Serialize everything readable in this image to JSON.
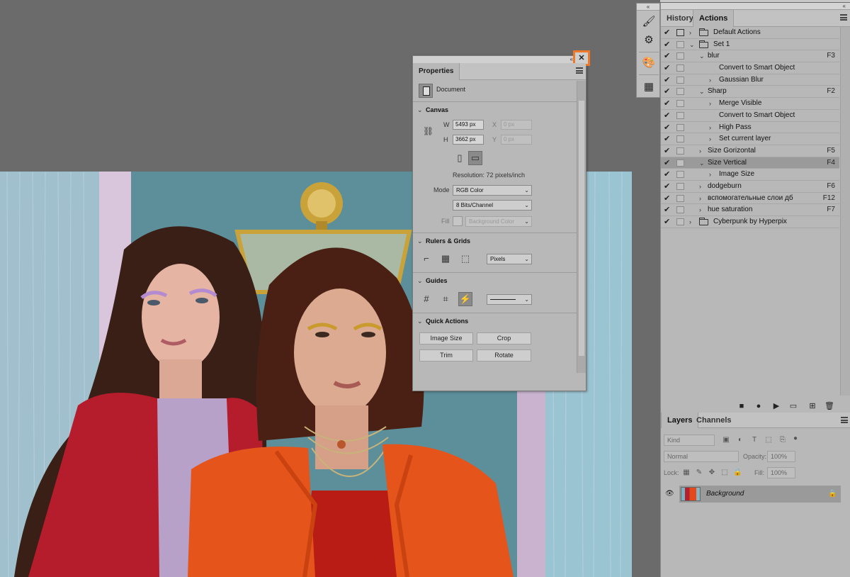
{
  "properties": {
    "tab": "Properties",
    "document_label": "Document",
    "canvas": {
      "title": "Canvas",
      "w_label": "W",
      "w_value": "5493 px",
      "h_label": "H",
      "h_value": "3662 px",
      "x_label": "X",
      "x_placeholder": "0 px",
      "y_label": "Y",
      "y_placeholder": "0 px",
      "resolution": "Resolution: 72 pixels/inch",
      "mode_label": "Mode",
      "mode_value": "RGB Color",
      "bits_value": "8 Bits/Channel",
      "fill_label": "Fill",
      "fill_value": "Background Color"
    },
    "rulers": {
      "title": "Rulers & Grids",
      "units": "Pixels"
    },
    "guides": {
      "title": "Guides"
    },
    "quick_actions": {
      "title": "Quick Actions",
      "buttons": [
        "Image Size",
        "Crop",
        "Trim",
        "Rotate"
      ]
    },
    "close_glyph": "✕",
    "collapse_glyph": "«"
  },
  "history_actions": {
    "tabs": [
      "History",
      "Actions"
    ],
    "active_tab": "Actions",
    "collapse_glyph": "«",
    "rows": [
      {
        "label": "Default Actions",
        "key": "",
        "level": 0,
        "caret": "›",
        "folder": true,
        "dialog": true,
        "selected": false
      },
      {
        "label": "Set 1",
        "key": "",
        "level": 0,
        "caret": "⌄",
        "folder": true,
        "dialog": false,
        "selected": false
      },
      {
        "label": "blur",
        "key": "F3",
        "level": 1,
        "caret": "⌄",
        "folder": false,
        "dialog": false,
        "selected": false
      },
      {
        "label": "Convert to Smart Object",
        "key": "",
        "level": 2,
        "caret": "",
        "folder": false,
        "dialog": false,
        "selected": false
      },
      {
        "label": "Gaussian Blur",
        "key": "",
        "level": 2,
        "caret": "›",
        "folder": false,
        "dialog": false,
        "selected": false
      },
      {
        "label": "Sharp",
        "key": "F2",
        "level": 1,
        "caret": "⌄",
        "folder": false,
        "dialog": false,
        "selected": false
      },
      {
        "label": "Merge Visible",
        "key": "",
        "level": 2,
        "caret": "›",
        "folder": false,
        "dialog": false,
        "selected": false
      },
      {
        "label": "Convert to Smart Object",
        "key": "",
        "level": 2,
        "caret": "",
        "folder": false,
        "dialog": false,
        "selected": false
      },
      {
        "label": "High Pass",
        "key": "",
        "level": 2,
        "caret": "›",
        "folder": false,
        "dialog": false,
        "selected": false
      },
      {
        "label": "Set current layer",
        "key": "",
        "level": 2,
        "caret": "›",
        "folder": false,
        "dialog": false,
        "selected": false
      },
      {
        "label": "Size Gorizontal",
        "key": "F5",
        "level": 1,
        "caret": "›",
        "folder": false,
        "dialog": false,
        "selected": false
      },
      {
        "label": "Size Vertical",
        "key": "F4",
        "level": 1,
        "caret": "⌄",
        "folder": false,
        "dialog": false,
        "selected": true
      },
      {
        "label": "Image Size",
        "key": "",
        "level": 2,
        "caret": "›",
        "folder": false,
        "dialog": false,
        "selected": false
      },
      {
        "label": "dodgeburn",
        "key": "F6",
        "level": 1,
        "caret": "›",
        "folder": false,
        "dialog": false,
        "selected": false
      },
      {
        "label": "вспомогательные слои дб",
        "key": "F12",
        "level": 1,
        "caret": "›",
        "folder": false,
        "dialog": false,
        "selected": false
      },
      {
        "label": "hue saturation",
        "key": "F7",
        "level": 1,
        "caret": "›",
        "folder": false,
        "dialog": false,
        "selected": false
      },
      {
        "label": "Cyberpunk by Hyperpix",
        "key": "",
        "level": 0,
        "caret": "›",
        "folder": true,
        "dialog": false,
        "selected": false
      }
    ],
    "check_glyph": "✔",
    "bottom_buttons": [
      {
        "name": "stop-icon",
        "glyph": "■"
      },
      {
        "name": "record-icon",
        "glyph": "●"
      },
      {
        "name": "play-icon",
        "glyph": "▶"
      },
      {
        "name": "new-set-icon",
        "glyph": "▭"
      },
      {
        "name": "new-action-icon",
        "glyph": "⊞"
      },
      {
        "name": "trash-icon",
        "glyph": "🗑"
      }
    ]
  },
  "layers": {
    "tabs": [
      "Layers",
      "Channels"
    ],
    "active_tab": "Layers",
    "kind_placeholder": "Kind",
    "blend_mode": "Normal",
    "opacity_label": "Opacity:",
    "opacity_value": "100%",
    "lock_label": "Lock:",
    "fill_label": "Fill:",
    "fill_value": "100%",
    "layer_name": "Background",
    "eye_glyph": "👁",
    "lock_glyph": "🔒"
  },
  "toolstrip": {
    "collapse_glyph": "«",
    "buttons": [
      {
        "name": "brush-settings-icon",
        "glyph": "🖌"
      },
      {
        "name": "brush-presets-icon",
        "glyph": "⚙"
      },
      {
        "name": "color-palette-icon",
        "glyph": "🎨"
      },
      {
        "name": "grid-table-icon",
        "glyph": "▦"
      }
    ]
  },
  "colors": {
    "accent_highlight": "#f0782a",
    "panel_bg": "#b8b8b8",
    "workspace_bg": "#6b6b6b"
  }
}
